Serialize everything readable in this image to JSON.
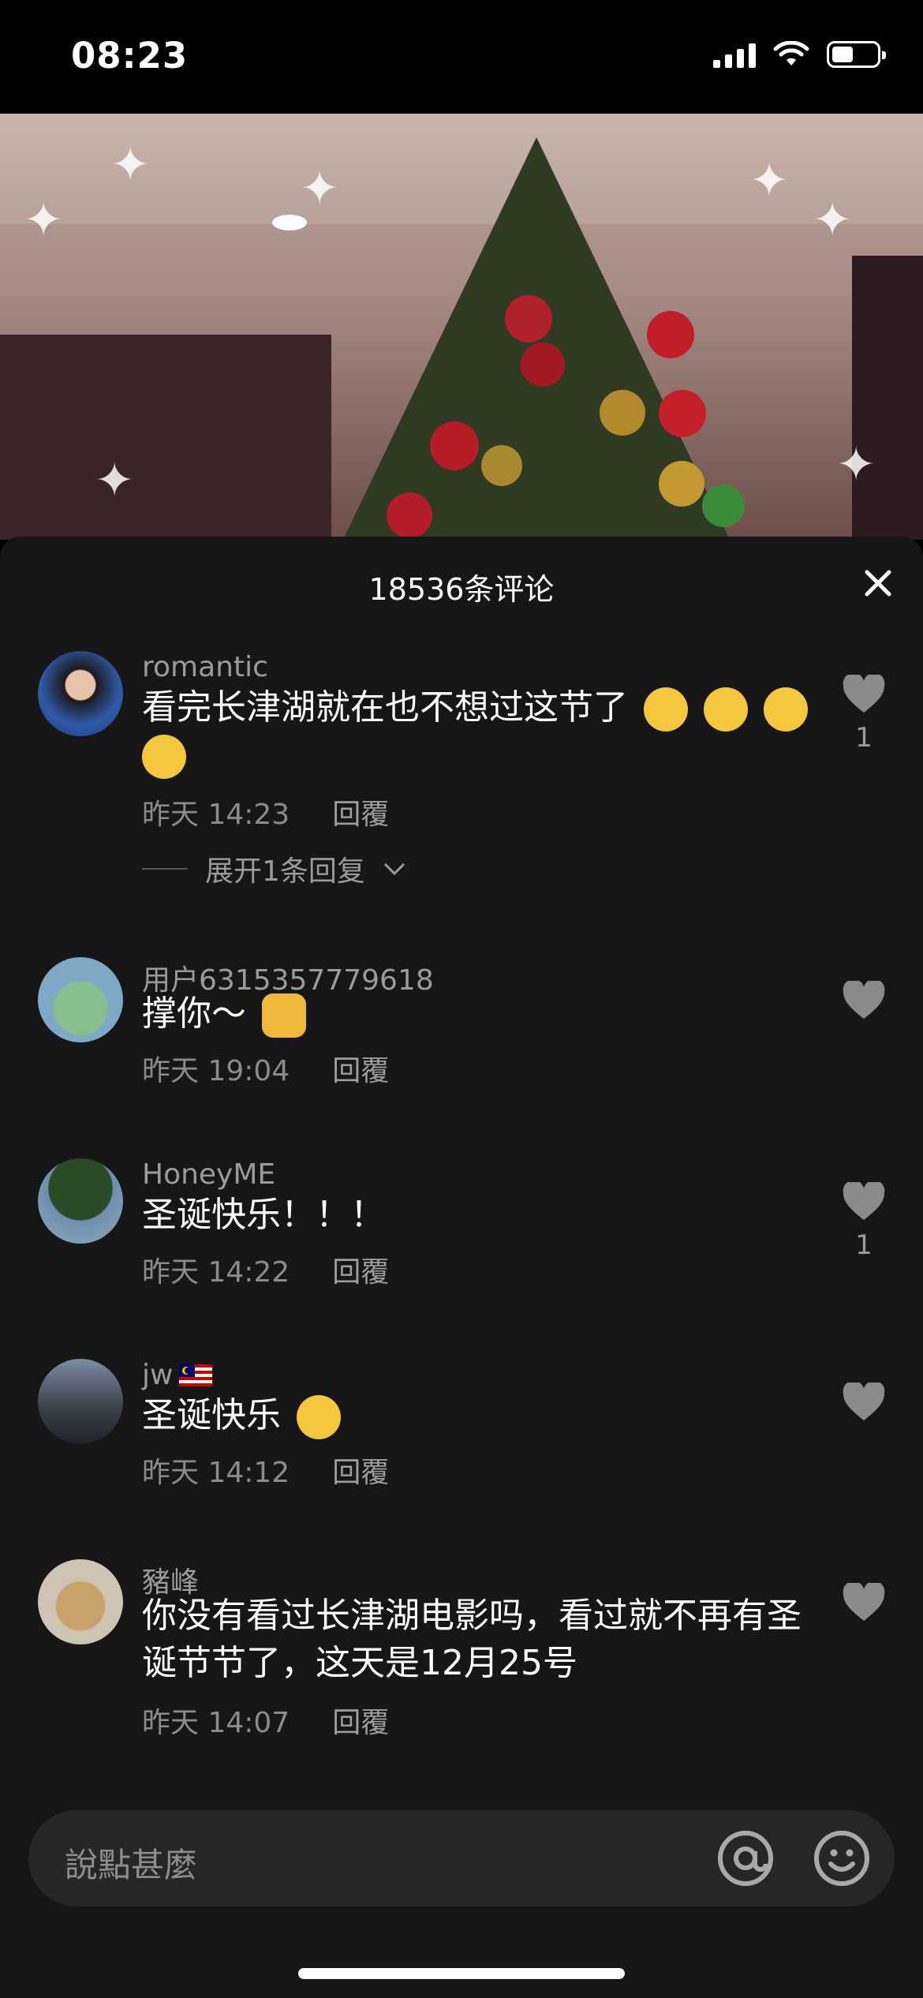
{
  "status_bar": {
    "time": "08:23"
  },
  "sheet": {
    "title": "18536条评论"
  },
  "comments": [
    {
      "username": "romantic",
      "text": "看完长津湖就在也不想过这节了",
      "emoji_count": 4,
      "date": "昨天 14:23",
      "reply_label": "回覆",
      "likes": "1",
      "expand_label": "展开1条回复"
    },
    {
      "username": "用户6315357779618",
      "text": "撑你～",
      "date": "昨天 19:04",
      "reply_label": "回覆",
      "likes": ""
    },
    {
      "username": "HoneyME",
      "text": "圣诞快乐！！！",
      "date": "昨天 14:22",
      "reply_label": "回覆",
      "likes": "1"
    },
    {
      "username": "jw",
      "text": "圣诞快乐",
      "date": "昨天 14:12",
      "reply_label": "回覆",
      "likes": ""
    },
    {
      "username": "豬峰",
      "text": "你没有看过长津湖电影吗，看过就不再有圣诞节节了，这天是12月25号",
      "date": "昨天 14:07",
      "reply_label": "回覆",
      "likes": ""
    }
  ],
  "input": {
    "placeholder": "說點甚麼"
  },
  "colors": {
    "sheet_bg": "#161616",
    "input_bg": "#262626",
    "muted_text": "#8b8b8b"
  }
}
